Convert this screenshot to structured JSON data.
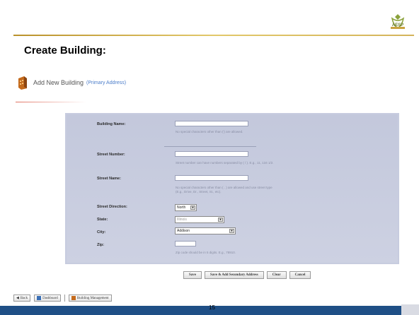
{
  "header": {
    "logo_text": "AESP",
    "slide_title": "Create Building:"
  },
  "section": {
    "title": "Add New Building",
    "subtitle": "(Primary Address)"
  },
  "form": {
    "building_name": {
      "label": "Building Name:",
      "value": "",
      "help": "No special characters other than (') are allowed."
    },
    "street_number": {
      "label": "Street Number:",
      "value": "",
      "help": "Street number can have numbers separated by ( / ). E.g., 11, 134 1/2."
    },
    "street_name": {
      "label": "Street Name:",
      "value": "",
      "help_line1": "No special characters other than ( . ) are allowed and use street type",
      "help_line2": "(E.g., Drive, Dr., Street, St., etc)."
    },
    "street_direction": {
      "label": "Street Direction:",
      "selected": "North"
    },
    "state": {
      "label": "State:",
      "selected": "Illinois"
    },
    "city": {
      "label": "City:",
      "selected": "Addison"
    },
    "zip": {
      "label": "Zip:",
      "value": "",
      "help": "Zip code should be in 5 digits. E.g., 78910."
    }
  },
  "buttons": {
    "save": "Save",
    "save_add_secondary": "Save & Add Secondary Address",
    "clear": "Clear",
    "cancel": "Cancel"
  },
  "nav": {
    "back": "Back",
    "dashboard": "Dashboard",
    "building_management": "Building Management"
  },
  "footer": {
    "page_number": "15"
  },
  "colors": {
    "gold_rule": "#c9a23f",
    "form_bg": "#c7ccdf",
    "footer_bar": "#1f4f86",
    "link_blue": "#4a7cc9"
  }
}
